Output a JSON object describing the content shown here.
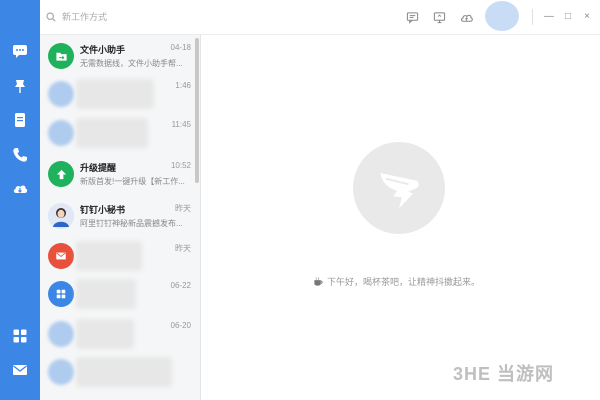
{
  "search": {
    "placeholder": "新工作方式"
  },
  "sidebar": {
    "icons": [
      "message-icon",
      "pin-icon",
      "notebook-icon",
      "phone-icon",
      "cloud-icon",
      "grid-apps-icon",
      "mail-icon"
    ]
  },
  "conversations": [
    {
      "title": "文件小助手",
      "preview": "无需数据线，文件小助手帮...",
      "time": "04-18",
      "avatar": "folder"
    },
    {
      "title": "",
      "preview": "",
      "time": "1:46",
      "avatar": "blurred"
    },
    {
      "title": "",
      "preview": "",
      "time": "11:45",
      "avatar": "blurred"
    },
    {
      "title": "升级提醒",
      "preview": "新版首发!一键升级【新工作...",
      "time": "10:52",
      "avatar": "upgrade"
    },
    {
      "title": "钉钉小秘书",
      "preview": "阿里钉钉神秘新品震撼发布...",
      "time": "昨天",
      "avatar": "person"
    },
    {
      "title": "",
      "preview": "",
      "time": "昨天",
      "avatar": "blurred-mail"
    },
    {
      "title": "",
      "preview": "",
      "time": "06-22",
      "avatar": "blurred-grid"
    },
    {
      "title": "",
      "preview": "",
      "time": "06-20",
      "avatar": "blurred"
    },
    {
      "title": "",
      "preview": "",
      "time": "",
      "avatar": "blurred"
    }
  ],
  "main": {
    "greeting": "下午好，喝杯茶吧，让精神抖擞起来。"
  },
  "watermark": "3HE 当游网",
  "window_controls": [
    "—",
    "□",
    "×"
  ]
}
